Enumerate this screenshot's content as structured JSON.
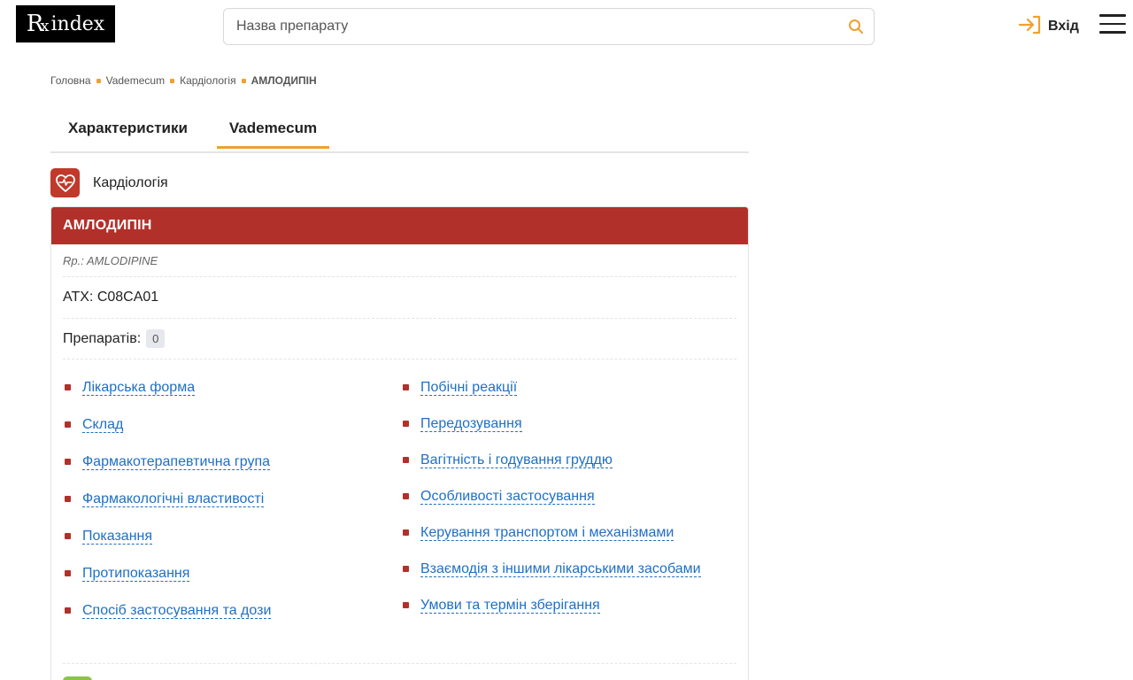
{
  "header": {
    "logo_rx": "R̷",
    "logo_text": "index",
    "search_placeholder": "Назва препарату",
    "login_label": "Вхід"
  },
  "breadcrumb": {
    "items": [
      "Головна",
      "Vademecum",
      "Кардіологія"
    ],
    "current": "АМЛОДИПІН"
  },
  "tabs": [
    {
      "label": "Характеристики",
      "active": false
    },
    {
      "label": "Vademecum",
      "active": true
    }
  ],
  "category": {
    "label": "Кардіологія"
  },
  "drug": {
    "title": "АМЛОДИПІН",
    "rp": "Rp.: AMLODIPINE",
    "atc": "ATX: C08CA01",
    "count_label": "Препаратів:",
    "count_value": "0"
  },
  "sections_left": [
    "Лікарська форма",
    "Склад",
    "Фармакотерапевтична група",
    "Фармакологічні властивості",
    "Показання",
    "Протипоказання",
    "Спосіб застосування та дози"
  ],
  "sections_right": [
    "Побічні реакції",
    "Передозування",
    "Вагітність і годування груддю",
    "Особливості застосування",
    "Керування транспортом і механізмами",
    "Взаємодія з іншими лікарськими засобами",
    "Умови та термін зберігання"
  ],
  "colors": {
    "accent": "#f0a030",
    "brand_red": "#b1312a",
    "link": "#1f6fc5"
  }
}
